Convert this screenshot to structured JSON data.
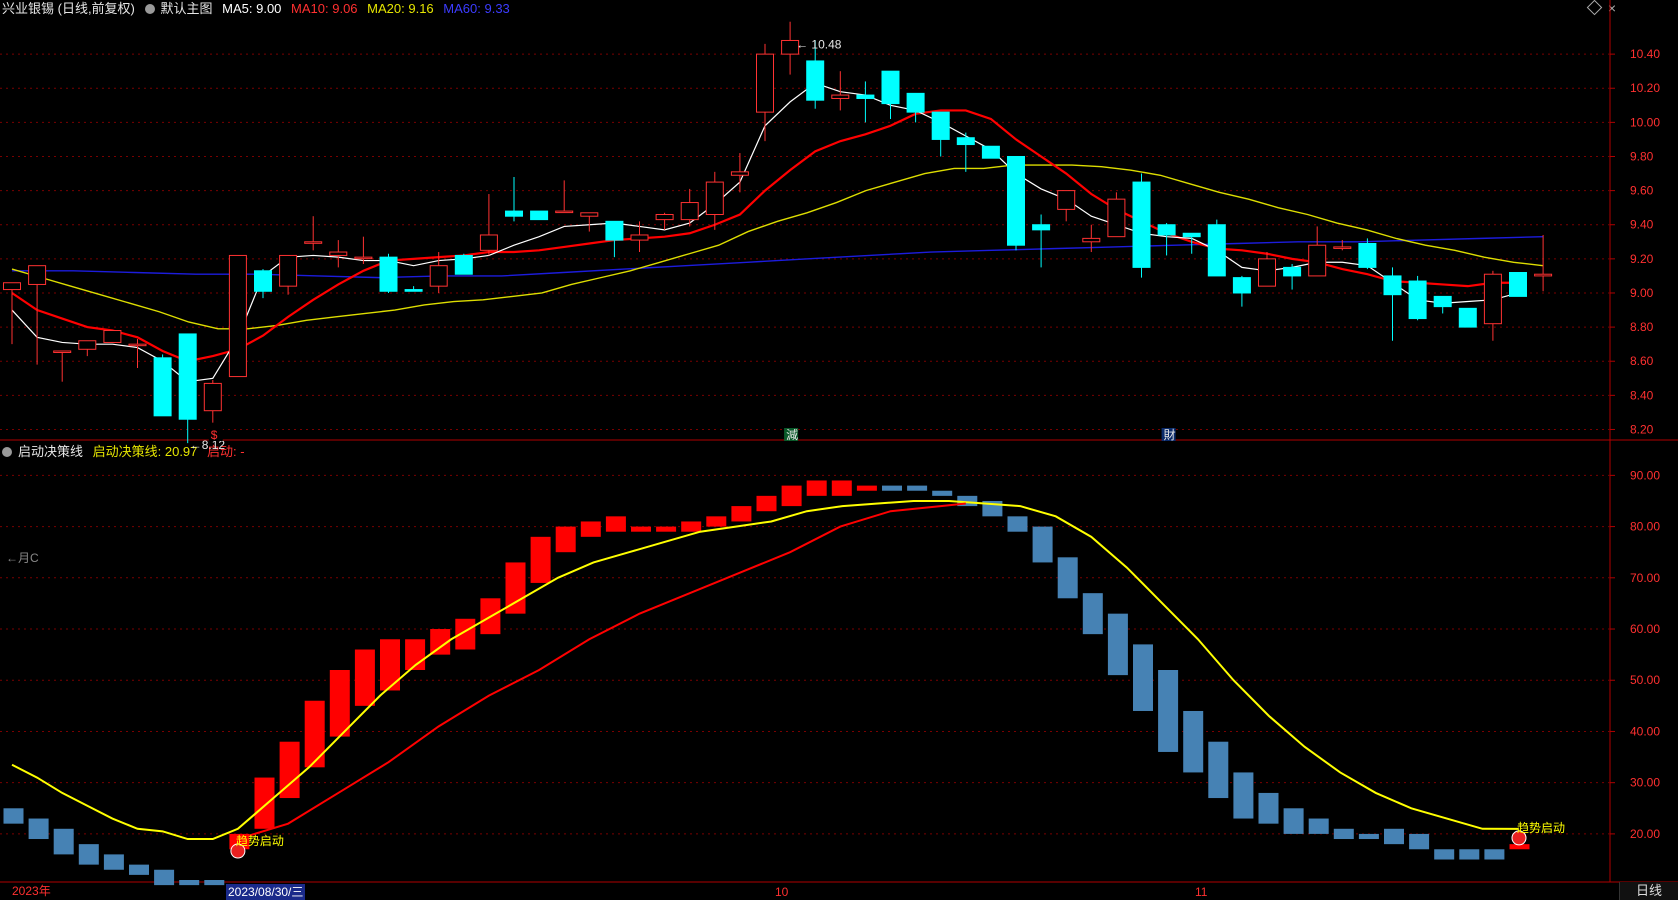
{
  "main_header": {
    "title": "兴业银锡 (日线,前复权)",
    "chart_name": "默认主图",
    "ma5": "MA5: 9.00",
    "ma10": "MA10: 9.06",
    "ma20": "MA20: 9.16",
    "ma60": "MA60: 9.33"
  },
  "sub_header": {
    "name": "启动决策线",
    "value": "启动决策线: 20.97",
    "signal": "启动: -"
  },
  "side_note": "←月C",
  "date_axis": {
    "year": "2023年",
    "cursor_date": "2023/08/30/三",
    "oct": "10",
    "nov": "11"
  },
  "period_tab": "日线",
  "colors": {
    "up": "#ff3232",
    "down": "#00ffff",
    "ma5": "#ffffff",
    "ma10": "#ff0000",
    "ma20": "#dddd00",
    "ma60": "#1c1cdd",
    "sub_up": "#ff0000",
    "sub_down": "#4682b4",
    "sub_line": "#ffff00",
    "grid": "#7a0000"
  },
  "chart_data": [
    {
      "type": "candlestick",
      "y_ticks": [
        "10.40",
        "10.20",
        "10.00",
        "9.80",
        "9.60",
        "9.40",
        "9.20",
        "9.00",
        "8.80",
        "8.60",
        "8.40",
        "8.20"
      ],
      "ylim": [
        8.15,
        10.6
      ],
      "high_label": "10.48",
      "low_label": "8.12",
      "event_markers": [
        "$",
        "減",
        "財"
      ],
      "candles": [
        [
          9.02,
          9.06,
          8.48,
          8.7
        ],
        [
          9.05,
          9.16,
          8.62,
          8.58
        ],
        [
          8.66,
          8.66,
          8.58,
          8.48
        ],
        [
          8.67,
          8.72,
          8.57,
          8.63
        ],
        [
          8.71,
          8.78,
          8.63,
          8.71
        ],
        [
          8.7,
          8.7,
          8.73,
          8.56
        ],
        [
          8.62,
          8.28,
          8.64,
          8.28
        ],
        [
          8.76,
          8.26,
          8.73,
          8.12
        ],
        [
          8.31,
          8.47,
          8.49,
          8.24
        ],
        [
          8.51,
          9.22,
          8.51,
          9.24
        ],
        [
          9.13,
          9.01,
          9.14,
          8.97
        ],
        [
          9.04,
          9.22,
          9.09,
          8.99
        ],
        [
          9.3,
          9.3,
          9.45,
          9.25
        ],
        [
          9.22,
          9.24,
          9.31,
          9.15
        ],
        [
          9.21,
          9.21,
          9.33,
          9.17
        ],
        [
          9.21,
          9.01,
          9.23,
          9.0
        ],
        [
          9.02,
          9.01,
          9.04,
          9.02
        ],
        [
          9.04,
          9.16,
          9.24,
          9.0
        ],
        [
          9.22,
          9.11,
          9.23,
          9.11
        ],
        [
          9.25,
          9.34,
          9.58,
          9.22
        ],
        [
          9.48,
          9.45,
          9.68,
          9.42
        ],
        [
          9.48,
          9.43,
          9.47,
          9.43
        ],
        [
          9.48,
          9.48,
          9.66,
          9.48
        ],
        [
          9.45,
          9.47,
          9.45,
          9.36
        ],
        [
          9.42,
          9.31,
          9.42,
          9.21
        ],
        [
          9.31,
          9.34,
          9.42,
          9.24
        ],
        [
          9.43,
          9.46,
          9.47,
          9.37
        ],
        [
          9.43,
          9.53,
          9.61,
          9.39
        ],
        [
          9.46,
          9.65,
          9.71,
          9.37
        ],
        [
          9.69,
          9.71,
          9.82,
          9.59
        ],
        [
          10.06,
          10.4,
          10.46,
          9.89
        ],
        [
          10.4,
          10.48,
          10.59,
          10.28
        ],
        [
          10.36,
          10.13,
          10.48,
          10.08
        ],
        [
          10.14,
          10.16,
          10.3,
          10.07
        ],
        [
          10.16,
          10.14,
          10.24,
          10.0
        ],
        [
          10.3,
          10.11,
          10.28,
          10.02
        ],
        [
          10.17,
          10.06,
          10.15,
          10.0
        ],
        [
          10.06,
          9.9,
          10.06,
          9.8
        ],
        [
          9.91,
          9.87,
          9.94,
          9.71
        ],
        [
          9.86,
          9.79,
          9.84,
          9.82
        ],
        [
          9.8,
          9.28,
          9.8,
          9.25
        ],
        [
          9.4,
          9.37,
          9.46,
          9.15
        ],
        [
          9.49,
          9.6,
          9.6,
          9.42
        ],
        [
          9.3,
          9.32,
          9.4,
          9.24
        ],
        [
          9.33,
          9.55,
          9.59,
          9.38
        ],
        [
          9.65,
          9.15,
          9.7,
          9.09
        ],
        [
          9.4,
          9.34,
          9.41,
          9.22
        ],
        [
          9.35,
          9.33,
          9.35,
          9.23
        ],
        [
          9.4,
          9.1,
          9.43,
          9.1
        ],
        [
          9.09,
          9.0,
          9.1,
          8.92
        ],
        [
          9.04,
          9.2,
          9.24,
          9.08
        ],
        [
          9.15,
          9.1,
          9.17,
          9.02
        ],
        [
          9.1,
          9.28,
          9.39,
          9.11
        ],
        [
          9.27,
          9.27,
          9.31,
          9.25
        ],
        [
          9.29,
          9.15,
          9.32,
          9.14
        ],
        [
          9.1,
          8.99,
          9.15,
          8.72
        ],
        [
          9.07,
          8.85,
          9.1,
          8.84
        ],
        [
          8.98,
          8.92,
          8.98,
          8.88
        ],
        [
          8.91,
          8.8,
          8.9,
          8.8
        ],
        [
          8.82,
          9.11,
          9.13,
          8.72
        ],
        [
          9.12,
          8.98,
          9.12,
          8.98
        ],
        [
          9.1,
          9.11,
          9.34,
          9.01
        ]
      ],
      "ma5": [
        8.9,
        8.74,
        8.71,
        8.7,
        8.7,
        8.68,
        8.6,
        8.48,
        8.5,
        8.74,
        9.1,
        9.21,
        9.22,
        9.21,
        9.19,
        9.19,
        9.16,
        9.19,
        9.2,
        9.22,
        9.28,
        9.33,
        9.39,
        9.4,
        9.41,
        9.39,
        9.37,
        9.41,
        9.52,
        9.65,
        9.98,
        10.12,
        10.23,
        10.18,
        10.16,
        10.1,
        10.07,
        10.0,
        9.92,
        9.84,
        9.7,
        9.61,
        9.55,
        9.45,
        9.4,
        9.35,
        9.33,
        9.32,
        9.25,
        9.15,
        9.13,
        9.15,
        9.18,
        9.18,
        9.16,
        9.06,
        8.96,
        8.94,
        8.95,
        8.96,
        9.0
      ],
      "ma10": [
        9.0,
        8.9,
        8.85,
        8.8,
        8.78,
        8.74,
        8.66,
        8.6,
        8.63,
        8.67,
        8.75,
        8.86,
        8.96,
        9.05,
        9.13,
        9.19,
        9.2,
        9.21,
        9.22,
        9.24,
        9.24,
        9.25,
        9.27,
        9.29,
        9.31,
        9.32,
        9.33,
        9.35,
        9.4,
        9.46,
        9.6,
        9.72,
        9.83,
        9.89,
        9.93,
        9.98,
        10.05,
        10.07,
        10.07,
        10.02,
        9.9,
        9.8,
        9.7,
        9.58,
        9.49,
        9.42,
        9.35,
        9.3,
        9.26,
        9.25,
        9.23,
        9.2,
        9.18,
        9.14,
        9.11,
        9.07,
        9.06,
        9.05,
        9.04,
        9.06,
        9.06
      ],
      "ma20": [
        9.14,
        9.09,
        9.04,
        8.99,
        8.94,
        8.89,
        8.83,
        8.79,
        8.79,
        8.81,
        8.84,
        8.86,
        8.88,
        8.9,
        8.93,
        8.95,
        8.96,
        8.98,
        9.0,
        9.05,
        9.09,
        9.13,
        9.18,
        9.23,
        9.28,
        9.36,
        9.42,
        9.47,
        9.53,
        9.6,
        9.65,
        9.7,
        9.73,
        9.73,
        9.75,
        9.75,
        9.75,
        9.74,
        9.72,
        9.69,
        9.64,
        9.59,
        9.55,
        9.5,
        9.46,
        9.41,
        9.37,
        9.32,
        9.28,
        9.25,
        9.21,
        9.18,
        9.16
      ],
      "ma60": [
        9.13,
        9.13,
        9.12,
        9.11,
        9.11,
        9.1,
        9.09,
        9.1,
        9.1,
        9.12,
        9.14,
        9.16,
        9.18,
        9.2,
        9.22,
        9.24,
        9.25,
        9.26,
        9.27,
        9.28,
        9.29,
        9.3,
        9.3,
        9.31,
        9.32,
        9.33
      ]
    },
    {
      "type": "bar",
      "name": "启动决策线",
      "y_ticks": [
        "90.00",
        "80.00",
        "70.00",
        "60.00",
        "50.00",
        "40.00",
        "30.00",
        "20.00"
      ],
      "ylim": [
        11,
        93
      ],
      "bars": [
        [
          22,
          25
        ],
        [
          19,
          23
        ],
        [
          16,
          21
        ],
        [
          14,
          18
        ],
        [
          13,
          16
        ],
        [
          12,
          14
        ],
        [
          10,
          13
        ],
        [
          10,
          11
        ],
        [
          10,
          11
        ],
        [
          17,
          20
        ],
        [
          21,
          31
        ],
        [
          27,
          38
        ],
        [
          33,
          46
        ],
        [
          39,
          52
        ],
        [
          45,
          56
        ],
        [
          48,
          58
        ],
        [
          52,
          58
        ],
        [
          55,
          60
        ],
        [
          56,
          62
        ],
        [
          59,
          66
        ],
        [
          63,
          73
        ],
        [
          69,
          78
        ],
        [
          75,
          80
        ],
        [
          78,
          81
        ],
        [
          79,
          82
        ],
        [
          79,
          80
        ],
        [
          79,
          80
        ],
        [
          79,
          81
        ],
        [
          80,
          82
        ],
        [
          81,
          84
        ],
        [
          83,
          86
        ],
        [
          84,
          88
        ],
        [
          86,
          89
        ],
        [
          86,
          89
        ],
        [
          87,
          88
        ],
        [
          87,
          88
        ],
        [
          87,
          88
        ],
        [
          86,
          87
        ],
        [
          84,
          86
        ],
        [
          82,
          85
        ],
        [
          79,
          82
        ],
        [
          73,
          80
        ],
        [
          66,
          74
        ],
        [
          59,
          67
        ],
        [
          51,
          63
        ],
        [
          44,
          57
        ],
        [
          36,
          52
        ],
        [
          32,
          44
        ],
        [
          27,
          38
        ],
        [
          23,
          32
        ],
        [
          22,
          28
        ],
        [
          20,
          25
        ],
        [
          20,
          23
        ],
        [
          19,
          21
        ],
        [
          19,
          20
        ],
        [
          18,
          21
        ],
        [
          17,
          20
        ],
        [
          15,
          17
        ],
        [
          15,
          17
        ],
        [
          15,
          17
        ],
        [
          17,
          18
        ]
      ],
      "bar_dirs": [
        0,
        0,
        0,
        0,
        0,
        0,
        0,
        0,
        0,
        1,
        1,
        1,
        1,
        1,
        1,
        1,
        1,
        1,
        1,
        1,
        1,
        1,
        1,
        1,
        1,
        1,
        1,
        1,
        1,
        1,
        1,
        1,
        1,
        1,
        1,
        0,
        0,
        0,
        0,
        0,
        0,
        0,
        0,
        0,
        0,
        0,
        0,
        0,
        0,
        0,
        0,
        0,
        0,
        0,
        0,
        0,
        0,
        0,
        0,
        0,
        1
      ],
      "decision_line": [
        33.5,
        31,
        28,
        25.5,
        23,
        21,
        20.5,
        19,
        19,
        21,
        27,
        33,
        40,
        47,
        53,
        58,
        62,
        66,
        70,
        73,
        75,
        77,
        79,
        80,
        81,
        83,
        84,
        84.5,
        85,
        85,
        84.5,
        84,
        82,
        78,
        72,
        65,
        58,
        50,
        43,
        37,
        32,
        28,
        25,
        23,
        21,
        20.97
      ],
      "signal_label": "趋势启动"
    }
  ]
}
